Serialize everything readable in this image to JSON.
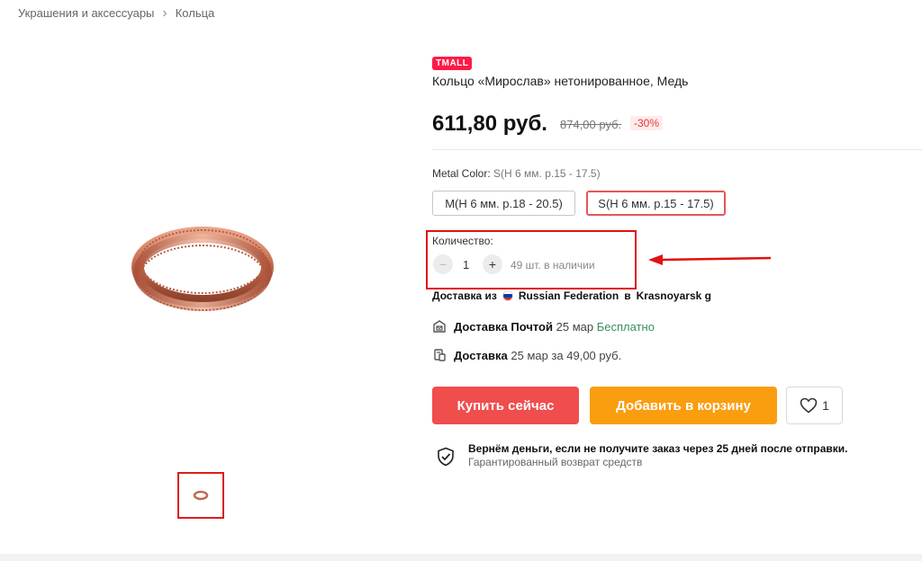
{
  "breadcrumb": {
    "items": [
      "Украшения и аксессуары",
      "Кольца"
    ],
    "separator": "›"
  },
  "product": {
    "badge": "TMALL",
    "title": "Кольцо «Мирослав» нетонированное, Медь",
    "price": "611,80 руб.",
    "old_price": "874,00 руб.",
    "discount": "-30%"
  },
  "options": {
    "label": "Metal Color:",
    "selected": "S(Н 6 мм. р.15 - 17.5)",
    "values": [
      "M(Н 6 мм. р.18 - 20.5)",
      "S(Н 6 мм. р.15 - 17.5)"
    ],
    "active_index": 1
  },
  "quantity": {
    "label": "Количество:",
    "minus": "−",
    "plus": "+",
    "value": "1",
    "stock": "49 шт. в наличии"
  },
  "delivery": {
    "from_prefix": "Доставка из",
    "from_country": "Russian Federation",
    "to_prefix": "в",
    "to_city": "Krasnoyarsk g",
    "post_label": "Доставка Почтой",
    "post_date": "25 мар",
    "post_price": "Бесплатно",
    "courier_label": "Доставка",
    "courier_date": "25 мар за 49,00 руб."
  },
  "actions": {
    "buy_now": "Купить сейчас",
    "add_to_cart": "Добавить в корзину",
    "wishlist_count": "1"
  },
  "guarantee": {
    "title": "Вернём деньги, если не получите заказ через 25 дней после отправки.",
    "subtitle": "Гарантированный возврат средств"
  },
  "colors": {
    "tmall": "#ff1a46",
    "buy_button": "#f04d4d",
    "cart_button": "#fa9d0f",
    "highlight": "#e01111",
    "free_text": "#3a8f5c"
  },
  "icons": [
    "ring-image",
    "chevron-right-icon",
    "russia-flag-icon",
    "post-office-icon",
    "courier-icon",
    "heart-icon",
    "shield-check-icon",
    "arrow-left-icon"
  ]
}
